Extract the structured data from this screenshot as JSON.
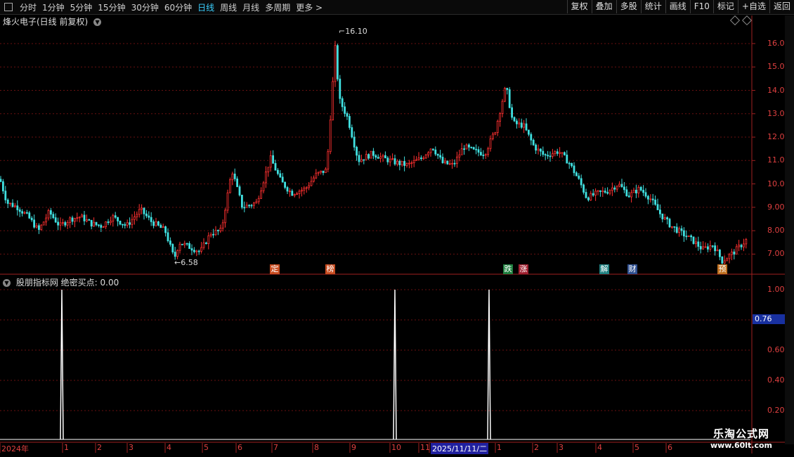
{
  "toolbar": {
    "tabs": [
      "分时",
      "1分钟",
      "5分钟",
      "15分钟",
      "30分钟",
      "60分钟",
      "日线",
      "周线",
      "月线",
      "多周期",
      "更多 >"
    ],
    "active_tab": "日线",
    "right_buttons": [
      "复权",
      "叠加",
      "多股",
      "统计",
      "画线",
      "F10",
      "标记",
      "+自选",
      "返回"
    ]
  },
  "main_chart": {
    "title": "烽火电子(日线 前复权)",
    "high_label": "16.10",
    "low_label": "6.58",
    "y_ticks": [
      "16.00",
      "15.00",
      "14.00",
      "13.00",
      "12.00",
      "11.00",
      "10.00",
      "9.00",
      "8.00",
      "7.00"
    ],
    "markers": [
      {
        "text": "定",
        "color": "#c84c20"
      },
      {
        "text": "榜",
        "color": "#c84c20"
      },
      {
        "text": "跌",
        "color": "#208040"
      },
      {
        "text": "涨",
        "color": "#a02030"
      },
      {
        "text": "解",
        "color": "#208080"
      },
      {
        "text": "财",
        "color": "#305090"
      },
      {
        "text": "预",
        "color": "#c07020"
      }
    ]
  },
  "indicator": {
    "title": "股朋指标网  绝密买点: 0.00",
    "y_ticks": [
      "1.00",
      "0.60",
      "0.40",
      "0.20"
    ],
    "cursor_value": "0.76"
  },
  "time_axis": {
    "labels": [
      "2024年",
      "1",
      "2",
      "3",
      "4",
      "5",
      "6",
      "7",
      "8",
      "9",
      "10",
      "11",
      "2025/11/11/二",
      "1",
      "2",
      "3",
      "4",
      "5",
      "6"
    ]
  },
  "watermark": {
    "line1": "乐淘公式网",
    "line2": "www.60lt.com"
  },
  "chart_data": {
    "type": "candlestick",
    "y_range": [
      6.2,
      16.6
    ],
    "anchors": [
      [
        0,
        10.2
      ],
      [
        10,
        9.2
      ],
      [
        25,
        9.0
      ],
      [
        40,
        8.6
      ],
      [
        55,
        8.0
      ],
      [
        70,
        8.8
      ],
      [
        85,
        8.2
      ],
      [
        100,
        8.5
      ],
      [
        115,
        8.6
      ],
      [
        130,
        8.3
      ],
      [
        145,
        8.2
      ],
      [
        160,
        8.6
      ],
      [
        180,
        8.2
      ],
      [
        200,
        8.9
      ],
      [
        215,
        8.4
      ],
      [
        235,
        8.0
      ],
      [
        248,
        6.8
      ],
      [
        255,
        7.5
      ],
      [
        270,
        7.3
      ],
      [
        285,
        7.1
      ],
      [
        300,
        7.9
      ],
      [
        315,
        8.0
      ],
      [
        330,
        10.6
      ],
      [
        345,
        9.0
      ],
      [
        365,
        9.2
      ],
      [
        385,
        11.1
      ],
      [
        400,
        10.1
      ],
      [
        415,
        9.6
      ],
      [
        435,
        9.8
      ],
      [
        450,
        10.4
      ],
      [
        465,
        10.6
      ],
      [
        477,
        15.8
      ],
      [
        483,
        13.6
      ],
      [
        495,
        12.8
      ],
      [
        510,
        11.0
      ],
      [
        530,
        11.3
      ],
      [
        545,
        11.1
      ],
      [
        565,
        10.9
      ],
      [
        580,
        10.8
      ],
      [
        600,
        11.1
      ],
      [
        615,
        11.6
      ],
      [
        630,
        10.9
      ],
      [
        645,
        10.8
      ],
      [
        660,
        11.6
      ],
      [
        675,
        11.4
      ],
      [
        690,
        11.3
      ],
      [
        705,
        12.3
      ],
      [
        720,
        14.2
      ],
      [
        730,
        12.6
      ],
      [
        745,
        12.5
      ],
      [
        760,
        11.6
      ],
      [
        775,
        11.2
      ],
      [
        795,
        11.4
      ],
      [
        810,
        10.9
      ],
      [
        825,
        10.1
      ],
      [
        835,
        9.4
      ],
      [
        850,
        9.6
      ],
      [
        865,
        9.7
      ],
      [
        880,
        10.0
      ],
      [
        895,
        9.5
      ],
      [
        910,
        9.8
      ],
      [
        925,
        9.4
      ],
      [
        940,
        8.7
      ],
      [
        955,
        8.2
      ],
      [
        970,
        7.9
      ],
      [
        985,
        7.6
      ],
      [
        1000,
        7.2
      ],
      [
        1015,
        7.4
      ],
      [
        1028,
        6.7
      ],
      [
        1045,
        7.1
      ],
      [
        1062,
        7.6
      ]
    ],
    "indicator_spikes": [
      {
        "index_x": 88,
        "value": 1.0
      },
      {
        "index_x": 562,
        "value": 1.0
      },
      {
        "index_x": 696,
        "value": 1.0
      }
    ]
  }
}
